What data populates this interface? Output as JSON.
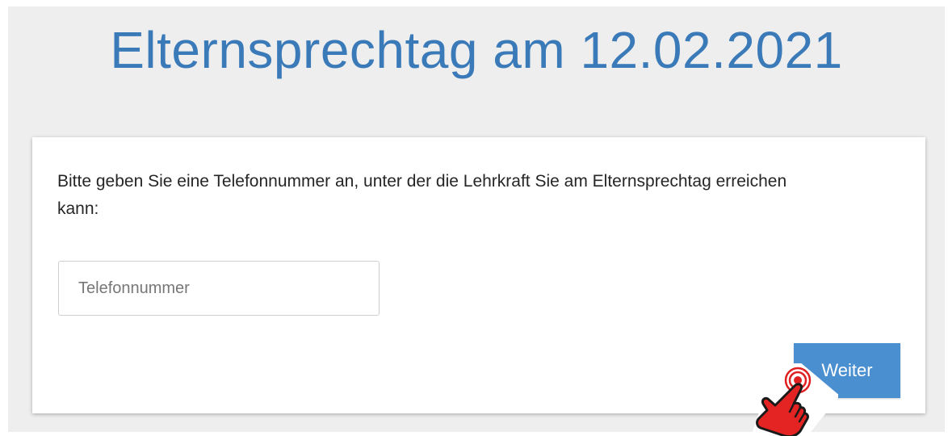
{
  "header": {
    "title": "Elternsprechtag am 12.02.2021"
  },
  "form": {
    "instruction": "Bitte geben Sie eine Telefonnummer an, unter der die Lehrkraft Sie am Elternsprechtag erreichen kann:",
    "phone_placeholder": "Telefonnummer",
    "phone_value": "",
    "submit_label": "Weiter"
  },
  "colors": {
    "title": "#3b7ab8",
    "button": "#4a8fd0",
    "background": "#eeeeee",
    "cursor": "#e02020"
  },
  "icons": {
    "cursor": "hand-pointer-icon"
  }
}
